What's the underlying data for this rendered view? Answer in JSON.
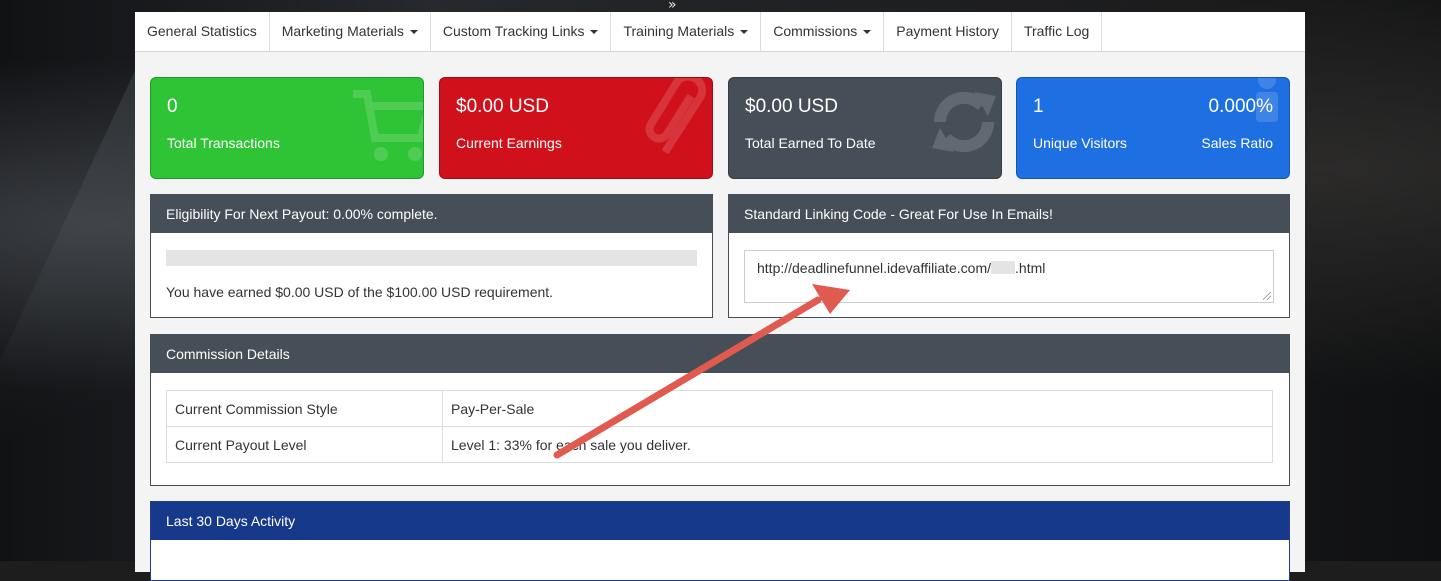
{
  "nav": {
    "items": [
      {
        "label": "General Statistics",
        "dropdown": false
      },
      {
        "label": "Marketing Materials",
        "dropdown": true
      },
      {
        "label": "Custom Tracking Links",
        "dropdown": true
      },
      {
        "label": "Training Materials",
        "dropdown": true
      },
      {
        "label": "Commissions",
        "dropdown": true
      },
      {
        "label": "Payment History",
        "dropdown": false
      },
      {
        "label": "Traffic Log",
        "dropdown": false
      }
    ]
  },
  "cards": {
    "transactions": {
      "value": "0",
      "label": "Total Transactions",
      "color": "#2fc436",
      "icon": "shopping-cart-icon"
    },
    "earnings": {
      "value": "$0.00 USD",
      "label": "Current Earnings",
      "color": "#d0111b",
      "icon": "paperclip-icon"
    },
    "earned_to_date": {
      "value": "$0.00 USD",
      "label": "Total Earned To Date",
      "color": "#464f57",
      "icon": "refresh-icon"
    },
    "visitors": {
      "value": "1",
      "label": "Unique Visitors",
      "ratio_value": "0.000%",
      "ratio_label": "Sales Ratio",
      "color": "#1e6fe1",
      "icon": "person-icon"
    }
  },
  "payout": {
    "title": "Eligibility For Next Payout: 0.00% complete.",
    "progress_percent": 0,
    "message": "You have earned $0.00 USD of the $100.00 USD requirement."
  },
  "linking": {
    "title": "Standard Linking Code - Great For Use In Emails!",
    "url_prefix": "http://deadlinefunnel.idevaffiliate.com/",
    "url_suffix": ".html"
  },
  "commission": {
    "title": "Commission Details",
    "rows": [
      {
        "key": "Current Commission Style",
        "value": "Pay-Per-Sale"
      },
      {
        "key": "Current Payout Level",
        "value": "Level 1: 33% for each sale you deliver."
      }
    ]
  },
  "activity": {
    "title": "Last 30 Days Activity"
  },
  "colors": {
    "arrow": "#e05a4f"
  }
}
